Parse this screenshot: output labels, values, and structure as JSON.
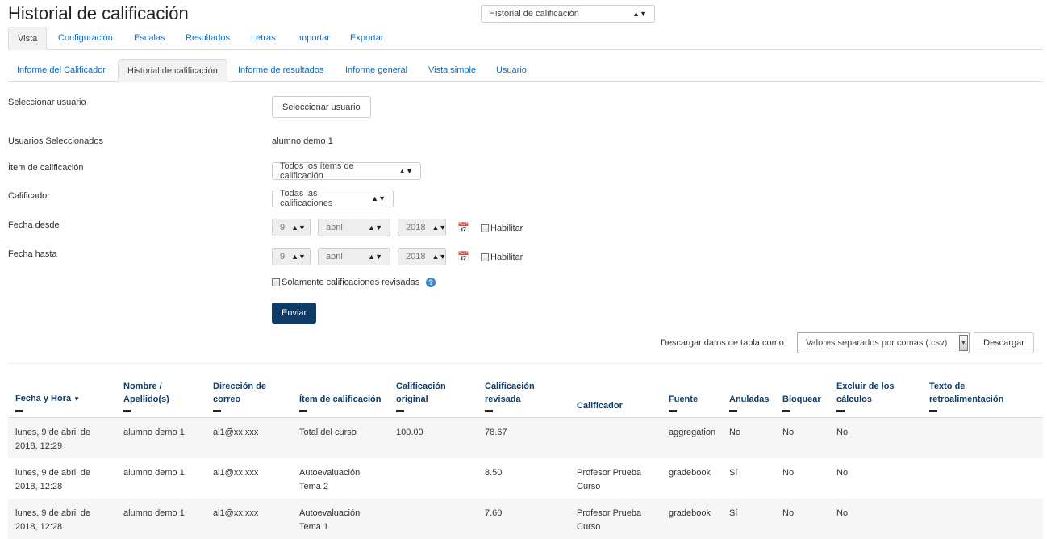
{
  "header": {
    "title": "Historial de calificación",
    "jump_select": "Historial de calificación"
  },
  "tabs_primary": [
    "Vista",
    "Configuración",
    "Escalas",
    "Resultados",
    "Letras",
    "Importar",
    "Exportar"
  ],
  "tabs_secondary": [
    "Informe del Calificador",
    "Historial de calificación",
    "Informe de resultados",
    "Informe general",
    "Vista simple",
    "Usuario"
  ],
  "form": {
    "select_user_label": "Seleccionar usuario",
    "select_user_button": "Seleccionar usuario",
    "selected_users_label": "Usuarios Seleccionados",
    "selected_users_value": "alumno demo 1",
    "grade_item_label": "Ítem de calificación",
    "grade_item_value": "Todos los ítems de calificación",
    "grader_label": "Calificador",
    "grader_value": "Todas las calificaciones",
    "date_from_label": "Fecha desde",
    "date_to_label": "Fecha hasta",
    "day": "9",
    "month": "abril",
    "year": "2018",
    "enable_label": "Habilitar",
    "revised_only_label": "Solamente calificaciones revisadas",
    "help_icon": "?",
    "calendar_icon": "calendar-icon",
    "submit_button": "Enviar"
  },
  "download": {
    "label": "Descargar datos de tabla como",
    "format": "Valores separados por comas (.csv)",
    "button": "Descargar"
  },
  "table": {
    "headers": [
      "Fecha y Hora",
      "Nombre / Apellido(s)",
      "Dirección de correo",
      "Ítem de calificación",
      "Calificación original",
      "Calificación revisada",
      "Calificador",
      "Fuente",
      "Anuladas",
      "Bloquear",
      "Excluir de los cálculos",
      "Texto de retroalimentación"
    ],
    "rows": [
      [
        "lunes, 9 de abril de 2018, 12:29",
        "alumno demo 1",
        "al1@xx.xxx",
        "Total del curso",
        "100.00",
        "78.67",
        "",
        "aggregation",
        "No",
        "No",
        "No",
        ""
      ],
      [
        "lunes, 9 de abril de 2018, 12:28",
        "alumno demo 1",
        "al1@xx.xxx",
        "Autoevaluación Tema 2",
        "",
        "8.50",
        "Profesor Prueba Curso",
        "gradebook",
        "Sí",
        "No",
        "No",
        ""
      ],
      [
        "lunes, 9 de abril de 2018, 12:28",
        "alumno demo 1",
        "al1@xx.xxx",
        "Autoevaluación Tema 1",
        "",
        "7.60",
        "Profesor Prueba Curso",
        "gradebook",
        "Sí",
        "No",
        "No",
        ""
      ]
    ]
  },
  "colors": {
    "link": "#0f6cbf",
    "header_text": "#0f3b68",
    "primary_button": "#0f3b68",
    "row_stripe": "#f6f6f6"
  }
}
